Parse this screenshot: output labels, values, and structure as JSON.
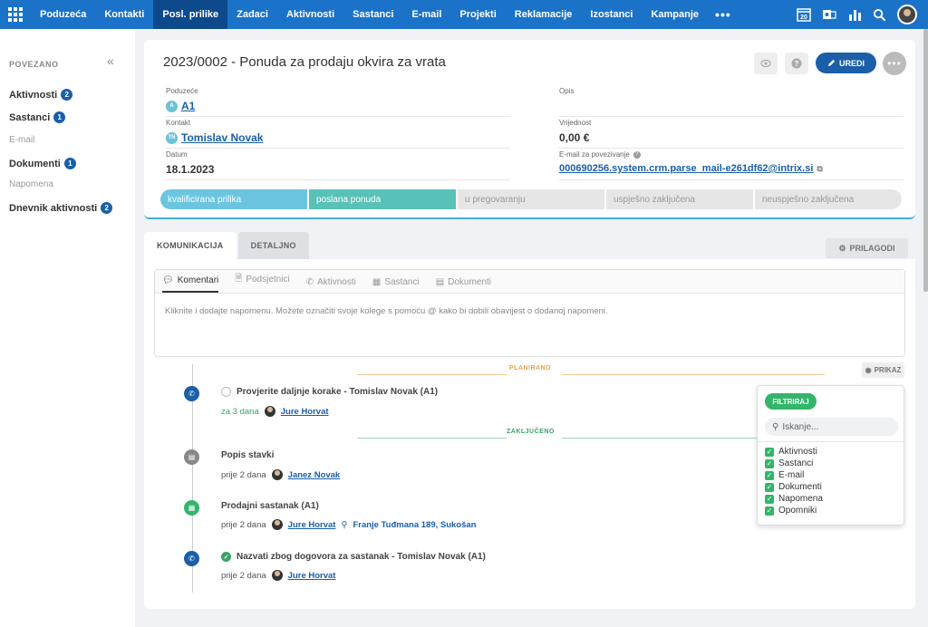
{
  "nav": {
    "items": [
      "Poduzeća",
      "Kontakti",
      "Posl. prilike",
      "Zadaci",
      "Aktivnosti",
      "Sastanci",
      "E-mail",
      "Projekti",
      "Reklamacije",
      "Izostanci",
      "Kampanje"
    ],
    "active_index": 2,
    "more": "•••",
    "calendar_day": "20",
    "icons": [
      "apps-grid-icon",
      "calendar-icon",
      "outlook-sync-icon",
      "reports-chart-icon",
      "search-icon",
      "user-avatar"
    ]
  },
  "sidebar": {
    "title": "POVEZANO",
    "collapse": "«",
    "items": [
      {
        "label": "Aktivnosti",
        "count": "2"
      },
      {
        "label": "Sastanci",
        "count": "1"
      },
      {
        "label": "E-mail",
        "count": ""
      },
      {
        "label": "Dokumenti",
        "count": "1"
      },
      {
        "label": "Napomena",
        "count": ""
      },
      {
        "label": "Dnevnik aktivnosti",
        "count": "2"
      }
    ]
  },
  "record": {
    "title": "2023/0002 - Ponuda za prodaju okvira za vrata",
    "edit_label": "UREDI",
    "more": "•••",
    "fields": {
      "company_label": "Poduzeće",
      "company_initial": "A",
      "company_value": "A1",
      "contact_label": "Kontakt",
      "contact_initials": "TN",
      "contact_value": "Tomislav Novak",
      "date_label": "Datum",
      "date_value": "18.1.2023",
      "description_label": "Opis",
      "description_value": "",
      "value_label": "Vrijednost",
      "value_value": "0,00 €",
      "email_label": "E-mail za povezivanje",
      "email_value": "000690256.system.crm.parse_mail-e261df62@intrix.si"
    },
    "stages": [
      "kvalificirana prilika",
      "poslana ponuda",
      "u pregovaranju",
      "uspješno zaključena",
      "neuspješno zaključena"
    ],
    "completed_stages": 2
  },
  "tabs": {
    "items": [
      "KOMUNIKACIJA",
      "DETALJNO"
    ],
    "customize": "PRILAGODI"
  },
  "composer": {
    "tabs": [
      "Komentari",
      "Podsjetnici",
      "Aktivnosti",
      "Sastanci",
      "Dokumenti"
    ],
    "placeholder": "Kliknite i dodajte napomenu. Možete označiti svoje kolege s pomoću @ kako bi dobili obavijest o dodanoj napomeni."
  },
  "timeline": {
    "planned_label": "PLANIRANO",
    "completed_label": "ZAKLJUČENO",
    "view_label": "PRIKAZ",
    "entries": [
      {
        "title": "Provjerite daljnje korake - Tomislav Novak (A1)",
        "when": "za 3 dana",
        "user": "Jure Horvat",
        "location": ""
      },
      {
        "title": "Popis stavki",
        "when": "prije 2 dana",
        "user": "Janez Novak",
        "location": ""
      },
      {
        "title": "Prodajni sastanak (A1)",
        "when": "prije 2 dana",
        "user": "Jure Horvat",
        "location": "Franje Tuđmana 189, Sukošan"
      },
      {
        "title": "Nazvati zbog dogovora za sastanak - Tomislav Novak (A1)",
        "when": "prije 2 dana",
        "user": "Jure Horvat",
        "location": ""
      }
    ]
  },
  "filter": {
    "button": "FILTRIRAJ",
    "search_placeholder": "Iskanje...",
    "options": [
      "Aktivnosti",
      "Sastanci",
      "E-mail",
      "Dokumenti",
      "Napomena",
      "Opomniki"
    ]
  },
  "colors": {
    "nav_bg": "#1a73c8",
    "nav_active": "#0d4a8c",
    "primary": "#1a5fa8",
    "stage_done_1": "#6bc5e0",
    "stage_done_2": "#59c2b8",
    "planned": "#f0a040",
    "completed": "#3aa16a",
    "filter_green": "#33b56a"
  }
}
